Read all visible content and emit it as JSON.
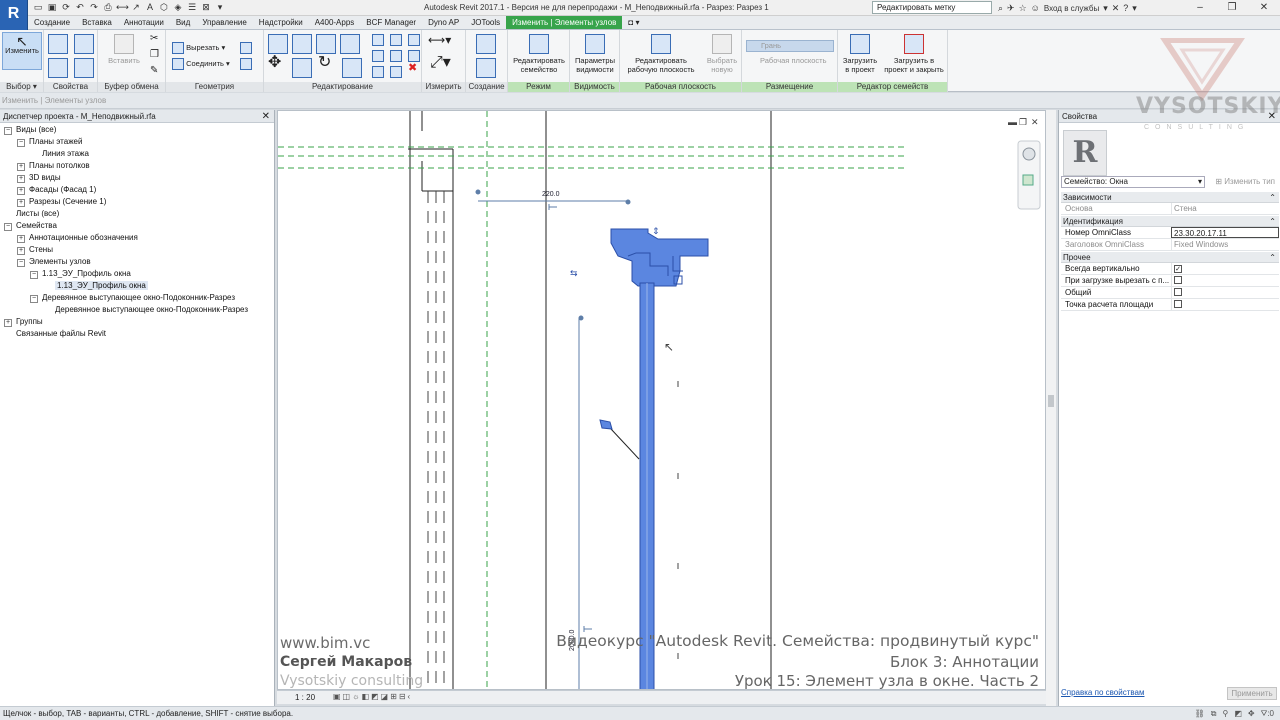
{
  "app": {
    "logo_letter": "R",
    "window_title": "Autodesk Revit 2017.1 - Версия не для перепродажи -    M_Неподвижный.rfa - Разрез: Разрез 1",
    "search_value": "Редактировать метку",
    "login_label": "Вход в службы",
    "qat_icons": [
      "open-icon",
      "save-icon",
      "sync-icon",
      "undo-icon",
      "redo-icon",
      "print-icon",
      "measure-icon",
      "text-icon",
      "3d-icon",
      "section-icon",
      "thin-lines-icon",
      "close-views-icon",
      "switch-windows-icon"
    ]
  },
  "ribbon_tabs": [
    {
      "label": "Создание",
      "state": ""
    },
    {
      "label": "Вставка",
      "state": ""
    },
    {
      "label": "Аннотации",
      "state": ""
    },
    {
      "label": "Вид",
      "state": ""
    },
    {
      "label": "Управление",
      "state": ""
    },
    {
      "label": "Надстройки",
      "state": ""
    },
    {
      "label": "A400-Apps",
      "state": ""
    },
    {
      "label": "BCF Manager",
      "state": ""
    },
    {
      "label": "Dyno AP",
      "state": ""
    },
    {
      "label": "JOTools",
      "state": ""
    },
    {
      "label": "Изменить | Элементы узлов",
      "state": "contextual"
    },
    {
      "label": "◘ ▾",
      "state": ""
    }
  ],
  "ribbon": {
    "modify_label": "Изменить",
    "paste_label": "Вставить",
    "cut_label": "Вырезать",
    "join_label": "Соединить",
    "edit_family_label": "Редактировать семейство",
    "vis_params_label": "Параметры видимости",
    "edit_workplane_label": "Редактировать рабочую плоскость",
    "pick_new_label": "Выбрать новую",
    "face_label": "Грань",
    "workplane_label": "Рабочая плоскость",
    "load_label": "Загрузить в проект",
    "load_close_label": "Загрузить в проект и закрыть",
    "panels": {
      "select": "Выбор ▾",
      "properties": "Свойства",
      "clipboard": "Буфер обмена",
      "geometry": "Геометрия",
      "modify": "Редактирование",
      "measure": "Измерить",
      "create": "Создание",
      "mode": "Режим",
      "visibility": "Видимость",
      "workplane": "Рабочая плоскость",
      "placement": "Размещение",
      "family_editor": "Редактор семейств"
    }
  },
  "options_bar": {
    "breadcrumb": "Изменить | Элементы узлов"
  },
  "browser": {
    "title": "Диспетчер проекта - M_Неподвижный.rfa",
    "items": [
      {
        "label": "Виды (все)",
        "level": 0,
        "toggle": "−"
      },
      {
        "label": "Планы этажей",
        "level": 1,
        "toggle": "−"
      },
      {
        "label": "Линия этажа",
        "level": 2,
        "toggle": ""
      },
      {
        "label": "Планы потолков",
        "level": 1,
        "toggle": "+"
      },
      {
        "label": "3D виды",
        "level": 1,
        "toggle": "+"
      },
      {
        "label": "Фасады (Фасад 1)",
        "level": 1,
        "toggle": "+"
      },
      {
        "label": "Разрезы (Сечение 1)",
        "level": 1,
        "toggle": "+"
      },
      {
        "label": "Листы (все)",
        "level": 0,
        "toggle": ""
      },
      {
        "label": "Семейства",
        "level": 0,
        "toggle": "−"
      },
      {
        "label": "Аннотационные обозначения",
        "level": 1,
        "toggle": "+"
      },
      {
        "label": "Стены",
        "level": 1,
        "toggle": "+"
      },
      {
        "label": "Элементы узлов",
        "level": 1,
        "toggle": "−"
      },
      {
        "label": "1.13_ЭУ_Профиль окна",
        "level": 2,
        "toggle": "−"
      },
      {
        "label": "1.13_ЭУ_Профиль окна",
        "level": 3,
        "toggle": "",
        "selected": true
      },
      {
        "label": "Деревянное выступающее окно-Подоконник-Разрез",
        "level": 2,
        "toggle": "−"
      },
      {
        "label": "Деревянное выступающее окно-Подоконник-Разрез",
        "level": 3,
        "toggle": ""
      },
      {
        "label": "Группы",
        "level": 0,
        "toggle": "+"
      },
      {
        "label": "Связанные файлы Revit",
        "level": 0,
        "toggle": ""
      }
    ]
  },
  "canvas": {
    "dim_top": "220.0",
    "dim_vert": "2000.0",
    "scale": "1 : 20"
  },
  "properties": {
    "title": "Свойства",
    "logo_letter": "R",
    "type_selector": "Семейство: Окна",
    "edit_type": "Изменить тип",
    "groups": {
      "constraints": "Зависимости",
      "identity": "Идентификация",
      "other": "Прочее"
    },
    "rows": {
      "host": {
        "name": "Основа",
        "value": "Стена"
      },
      "omniclass_num": {
        "name": "Номер OmniClass",
        "value": "23.30.20.17.11"
      },
      "omniclass_title": {
        "name": "Заголовок OmniClass",
        "value": "Fixed Windows"
      },
      "always_vertical": {
        "name": "Всегда вертикально",
        "value": "✓"
      },
      "cut_on_load": {
        "name": "При загрузке вырезать с п...",
        "value": ""
      },
      "shared": {
        "name": "Общий",
        "value": ""
      },
      "room_calc": {
        "name": "Точка расчета площади",
        "value": ""
      }
    },
    "help_link": "Справка по свойствам",
    "apply_label": "Применить"
  },
  "status": {
    "text": "Щелчок - выбор, TAB - варианты, CTRL - добавление, SHIFT - снятие выбора.",
    "filter_count": ":0"
  },
  "watermark": {
    "name": "VYSOTSKIY",
    "sub": "CONSULTING"
  },
  "overlay": {
    "site": "www.bim.vc",
    "author": "Сергей Макаров",
    "company": "Vysotskiy consulting",
    "course": "Видеокурс \"Autodesk Revit. Семейства: продвинутый курс\"",
    "block": "Блок 3: Аннотации",
    "lesson": "Урок 15: Элемент узла в окне. Часть 2"
  },
  "colors": {
    "accent": "#37a44b",
    "brand": "#2a64b4",
    "selection": "#5b86e0"
  }
}
